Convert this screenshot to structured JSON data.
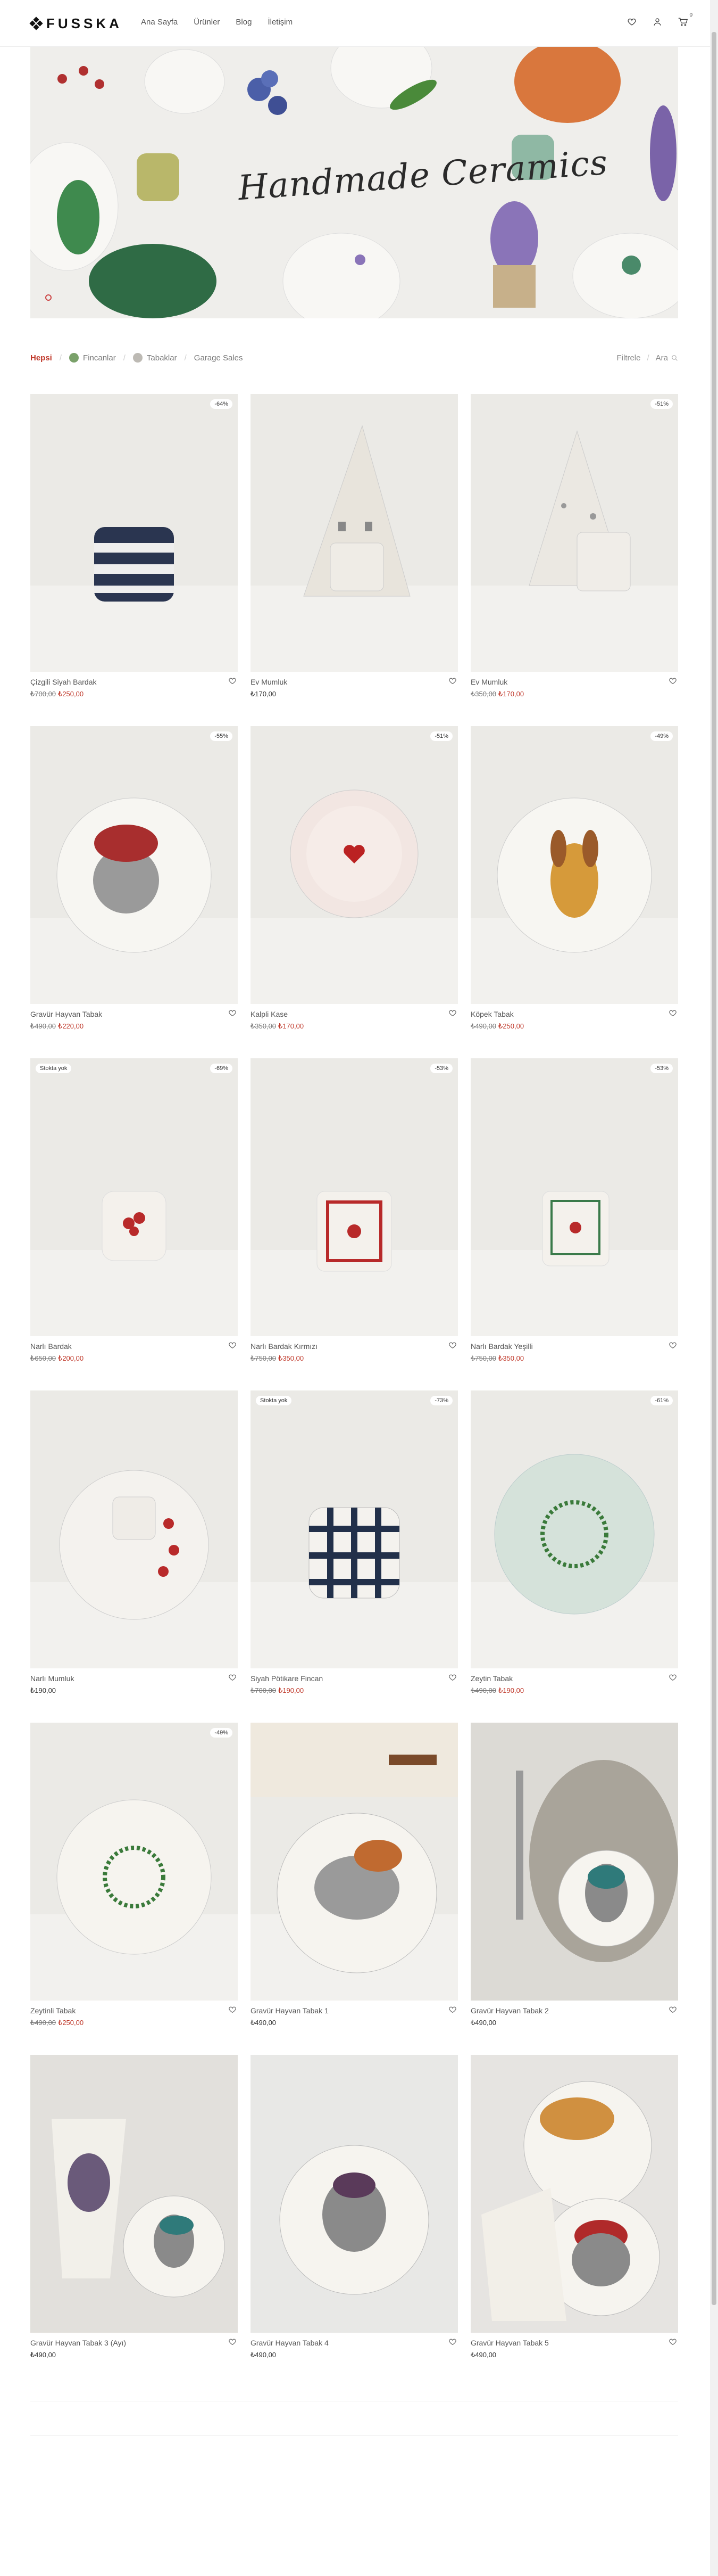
{
  "header": {
    "logo": "FUSSKA",
    "nav": [
      "Ana Sayfa",
      "Ürünler",
      "Blog",
      "İletişim"
    ],
    "cart_count": "0",
    "icons": [
      "heart-icon",
      "user-icon",
      "cart-icon"
    ]
  },
  "hero": {
    "title": "Handmade Ceramics"
  },
  "filters": {
    "categories": [
      "Hepsi",
      "Fincanlar",
      "Tabaklar",
      "Garage Sales"
    ],
    "filter_label": "Filtrele",
    "search_label": "Ara"
  },
  "colors": {
    "accent": "#c0392b",
    "text": "#333333",
    "muted": "#777777"
  },
  "products": [
    {
      "name": "Çizgili Siyah Bardak",
      "old": "₺700,00",
      "price": "₺250,00",
      "badge": "-64%",
      "oos": ""
    },
    {
      "name": "Ev Mumluk",
      "old": "",
      "price": "₺170,00",
      "badge": "",
      "oos": ""
    },
    {
      "name": "Ev Mumluk",
      "old": "₺350,00",
      "price": "₺170,00",
      "badge": "-51%",
      "oos": ""
    },
    {
      "name": "Gravür Hayvan Tabak",
      "old": "₺490,00",
      "price": "₺220,00",
      "badge": "-55%",
      "oos": ""
    },
    {
      "name": "Kalpli Kase",
      "old": "₺350,00",
      "price": "₺170,00",
      "badge": "-51%",
      "oos": ""
    },
    {
      "name": "Köpek Tabak",
      "old": "₺490,00",
      "price": "₺250,00",
      "badge": "-49%",
      "oos": ""
    },
    {
      "name": "Narlı Bardak",
      "old": "₺650,00",
      "price": "₺200,00",
      "badge": "-69%",
      "oos": "Stokta yok"
    },
    {
      "name": "Narlı Bardak Kırmızı",
      "old": "₺750,00",
      "price": "₺350,00",
      "badge": "-53%",
      "oos": ""
    },
    {
      "name": "Narlı Bardak Yeşilli",
      "old": "₺750,00",
      "price": "₺350,00",
      "badge": "-53%",
      "oos": ""
    },
    {
      "name": "Narlı Mumluk",
      "old": "",
      "price": "₺190,00",
      "badge": "",
      "oos": ""
    },
    {
      "name": "Siyah Pötikare Fincan",
      "old": "₺700,00",
      "price": "₺190,00",
      "badge": "-73%",
      "oos": "Stokta yok"
    },
    {
      "name": "Zeytin Tabak",
      "old": "₺490,00",
      "price": "₺190,00",
      "badge": "-61%",
      "oos": ""
    },
    {
      "name": "Zeytinli Tabak",
      "old": "₺490,00",
      "price": "₺250,00",
      "badge": "-49%",
      "oos": ""
    },
    {
      "name": "Gravür Hayvan Tabak 1",
      "old": "",
      "price": "₺490,00",
      "badge": "",
      "oos": ""
    },
    {
      "name": "Gravür Hayvan Tabak 2",
      "old": "",
      "price": "₺490,00",
      "badge": "",
      "oos": ""
    },
    {
      "name": "Gravür Hayvan Tabak 3 (Ayı)",
      "old": "",
      "price": "₺490,00",
      "badge": "",
      "oos": ""
    },
    {
      "name": "Gravür Hayvan Tabak 4",
      "old": "",
      "price": "₺490,00",
      "badge": "",
      "oos": ""
    },
    {
      "name": "Gravür Hayvan Tabak 5",
      "old": "",
      "price": "₺490,00",
      "badge": "",
      "oos": ""
    }
  ]
}
